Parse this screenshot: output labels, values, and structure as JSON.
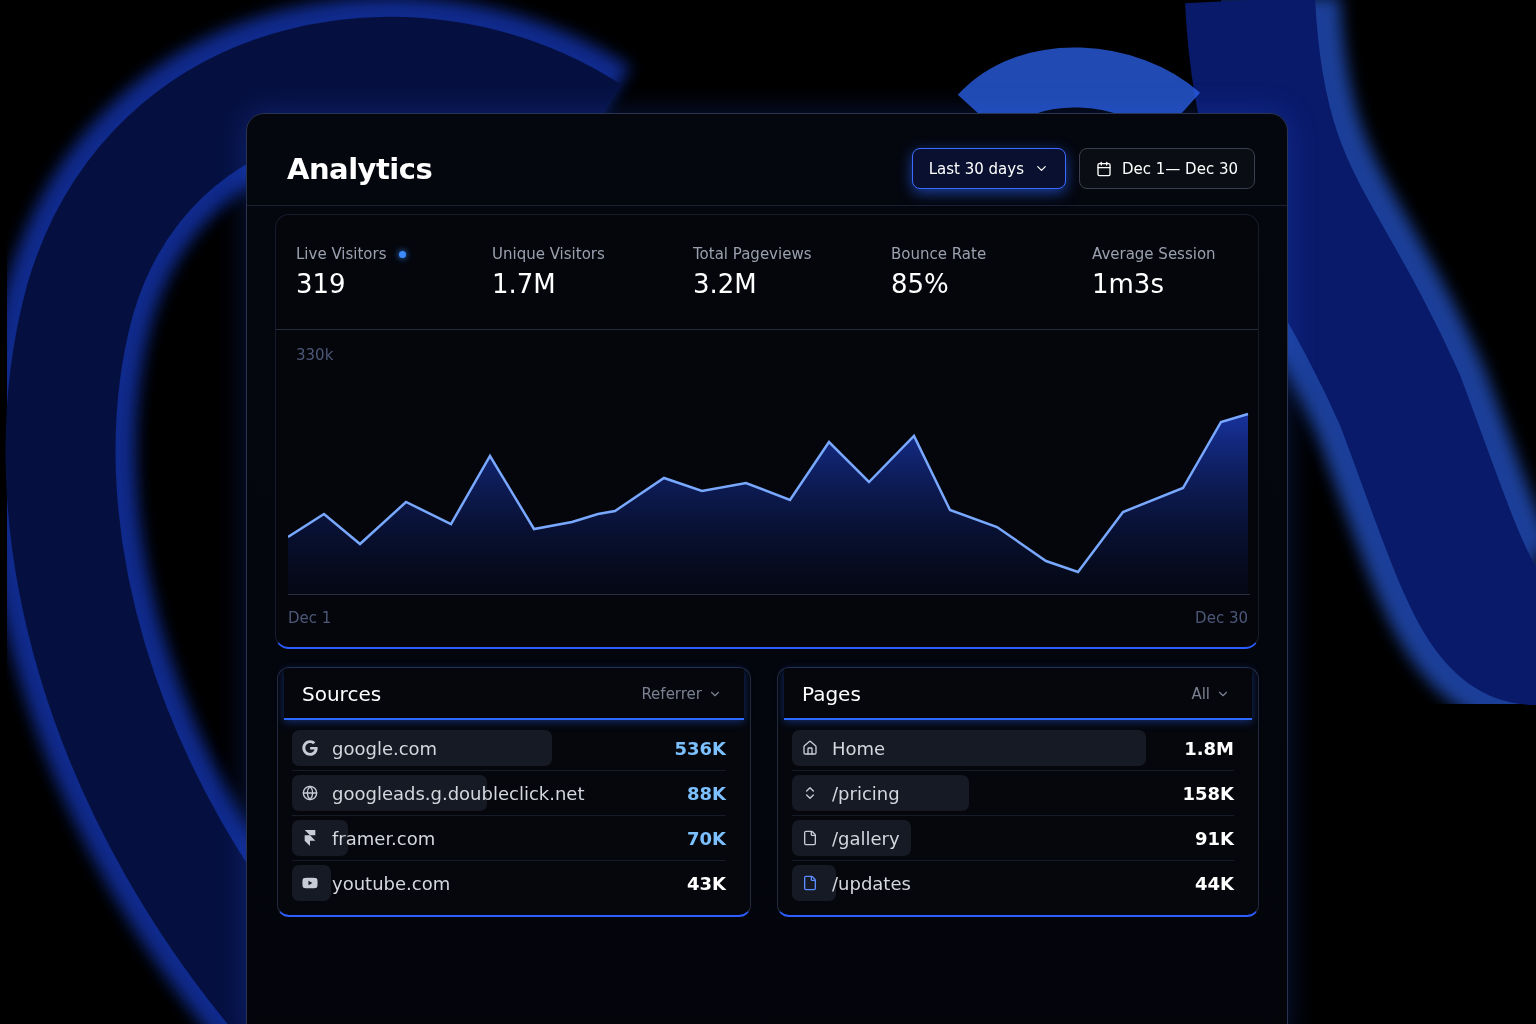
{
  "header": {
    "title": "Analytics",
    "range_button": {
      "label": "Last 30 days",
      "active": true
    },
    "date_button": {
      "label": "Dec 1— Dec 30",
      "active": false
    }
  },
  "stats": [
    {
      "label": "Live Visitors",
      "value": "319",
      "live": true
    },
    {
      "label": "Unique Visitors",
      "value": "1.7M",
      "live": false
    },
    {
      "label": "Total Pageviews",
      "value": "3.2M",
      "live": false
    },
    {
      "label": "Bounce Rate",
      "value": "85%",
      "live": false
    },
    {
      "label": "Average Session",
      "value": "1m3s",
      "live": false
    }
  ],
  "chart": {
    "top_label": "330k",
    "x_start": "Dec 1",
    "x_end": "Dec 30"
  },
  "sources": {
    "title": "Sources",
    "filter": "Referrer",
    "rows": [
      {
        "name": "google.com",
        "value": "536K",
        "level": 0.6,
        "accent": true
      },
      {
        "name": "googleads.g.doubleclick.net",
        "value": "88K",
        "level": 0.45,
        "accent": true
      },
      {
        "name": "framer.com",
        "value": "70K",
        "level": 0.13,
        "accent": true
      },
      {
        "name": "youtube.com",
        "value": "43K",
        "level": 0.09,
        "accent": false
      }
    ]
  },
  "pages": {
    "title": "Pages",
    "filter": "All",
    "rows": [
      {
        "name": "Home",
        "value": "1.8M",
        "level": 0.8,
        "accent": false
      },
      {
        "name": "/pricing",
        "value": "158K",
        "level": 0.4,
        "accent": false
      },
      {
        "name": "/gallery",
        "value": "91K",
        "level": 0.27,
        "accent": false
      },
      {
        "name": "/updates",
        "value": "44K",
        "level": 0.1,
        "accent": false
      }
    ]
  }
}
